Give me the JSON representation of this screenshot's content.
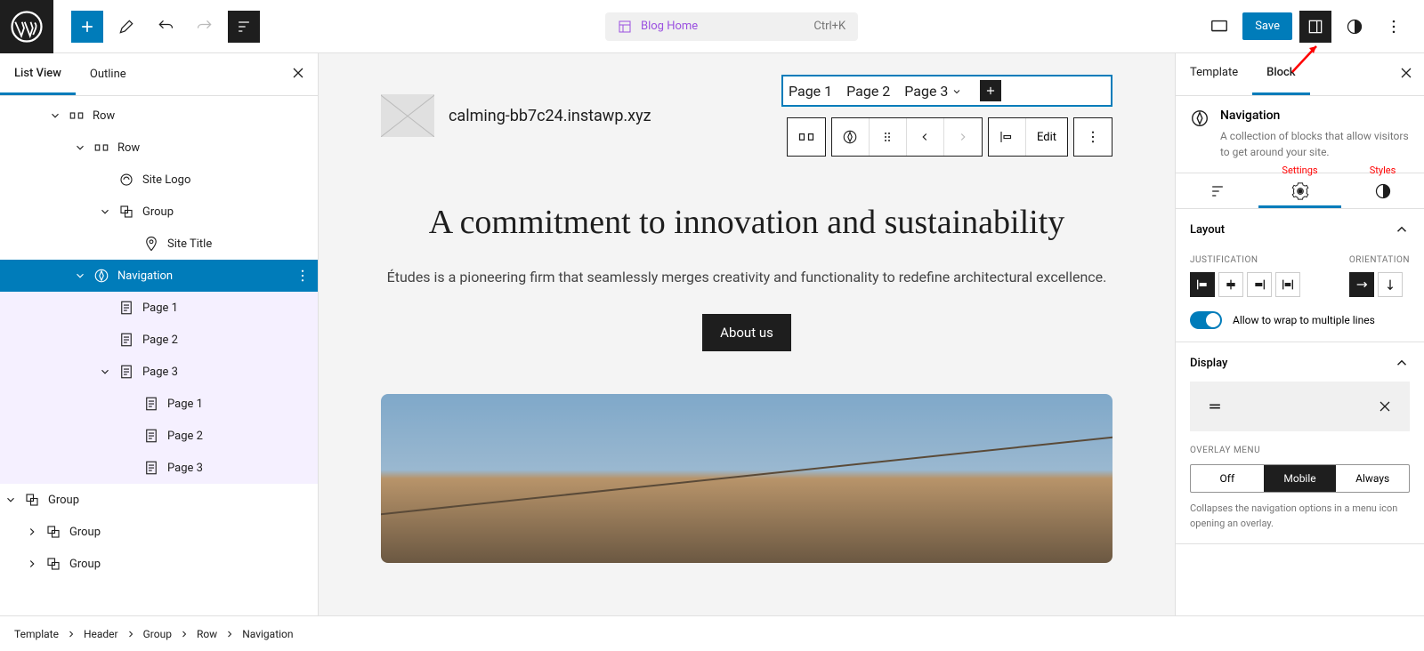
{
  "top": {
    "doc_title": "Blog Home",
    "shortcut": "Ctrl+K",
    "save_label": "Save"
  },
  "left_panel": {
    "tabs": {
      "list_view": "List View",
      "outline": "Outline"
    },
    "tree": {
      "row1": "Row",
      "row2": "Row",
      "site_logo": "Site Logo",
      "group1": "Group",
      "site_title": "Site Title",
      "navigation": "Navigation",
      "page1": "Page 1",
      "page2": "Page 2",
      "page3": "Page 3",
      "sub_page1": "Page 1",
      "sub_page2": "Page 2",
      "sub_page3": "Page 3",
      "group2": "Group",
      "group3": "Group",
      "group4": "Group"
    }
  },
  "canvas": {
    "site_title": "calming-bb7c24.instawp.xyz",
    "nav": {
      "p1": "Page 1",
      "p2": "Page 2",
      "p3": "Page 3"
    },
    "toolbar": {
      "edit": "Edit"
    },
    "hero_title": "A commitment to innovation and sustainability",
    "hero_sub": "Études is a pioneering firm that seamlessly merges creativity and functionality to redefine architectural excellence.",
    "hero_btn": "About us"
  },
  "right_panel": {
    "tabs": {
      "template": "Template",
      "block": "Block"
    },
    "block": {
      "title": "Navigation",
      "desc": "A collection of blocks that allow visitors to get around your site."
    },
    "subtabs": {
      "settings": "Settings",
      "styles": "Styles"
    },
    "layout": {
      "title": "Layout",
      "justification": "JUSTIFICATION",
      "orientation": "ORIENTATION",
      "wrap_label": "Allow to wrap to multiple lines"
    },
    "display": {
      "title": "Display",
      "overlay_menu": "OVERLAY MENU",
      "off": "Off",
      "mobile": "Mobile",
      "always": "Always",
      "help": "Collapses the navigation options in a menu icon opening an overlay."
    }
  },
  "breadcrumb": {
    "template": "Template",
    "header": "Header",
    "group": "Group",
    "row": "Row",
    "navigation": "Navigation"
  }
}
